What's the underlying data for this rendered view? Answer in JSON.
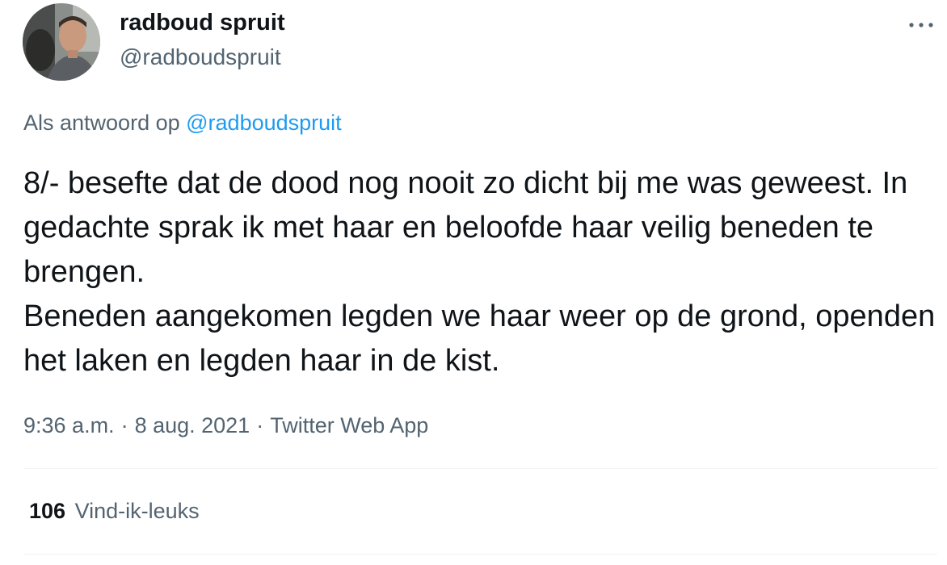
{
  "author": {
    "display_name": "radboud spruit",
    "handle": "@radboudspruit",
    "avatar_icon": "profile-photo"
  },
  "menu": {
    "icon": "more-horizontal-icon"
  },
  "reply": {
    "prefix": "Als antwoord op",
    "mention": "@radboudspruit"
  },
  "tweet": {
    "paragraphs": [
      "8/- besefte dat de dood nog nooit zo dicht bij me was geweest. In gedachte sprak ik met haar en beloofde haar veilig beneden te brengen.",
      "Beneden aangekomen legden we haar weer op de grond, openden het laken en legden haar in de kist."
    ]
  },
  "meta": {
    "time": "9:36 a.m.",
    "separator": "·",
    "date": "8 aug. 2021",
    "source": "Twitter Web App"
  },
  "stats": {
    "likes_count": "106",
    "likes_label": "Vind-ik-leuks"
  },
  "colors": {
    "text": "#0f1419",
    "secondary": "#536471",
    "link": "#1d9bf0",
    "divider": "#eff3f4"
  }
}
